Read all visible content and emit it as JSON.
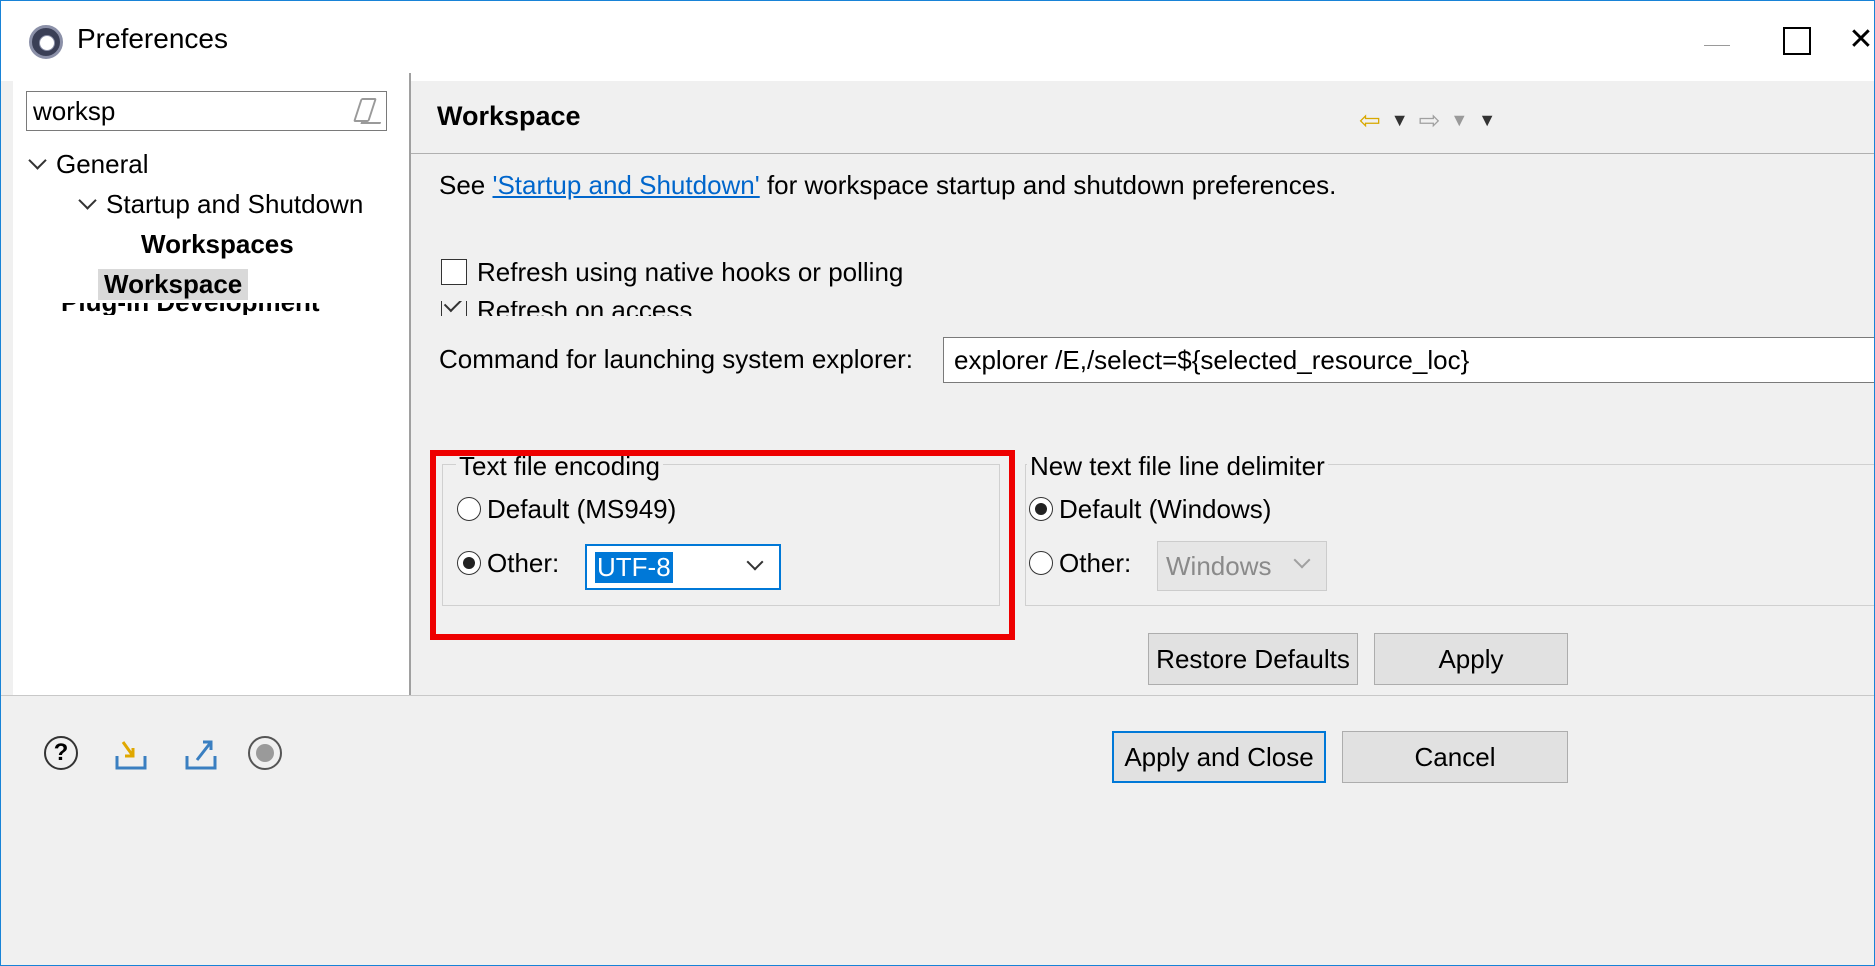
{
  "window": {
    "title": "Preferences",
    "close_glyph": "✕"
  },
  "sidebar": {
    "filter_value": "worksp",
    "tree": {
      "general": "General",
      "startup_shutdown": "Startup and Shutdown",
      "workspaces": "Workspaces",
      "workspace": "Workspace",
      "partial_item": "Plug-in Development"
    }
  },
  "page": {
    "title": "Workspace",
    "nav": {
      "back_glyph": "⇦",
      "forward_glyph": "⇨",
      "menu_glyph": "▼"
    },
    "description": {
      "prefix": "See ",
      "link": "'Startup and Shutdown'",
      "suffix": " for workspace startup and shutdown preferences."
    },
    "checkboxes": {
      "refresh_native": {
        "label": "Refresh using native hooks or polling",
        "checked": false
      },
      "refresh_access": {
        "label": "Refresh on access",
        "checked": true
      }
    },
    "explorer": {
      "label": "Command for launching system explorer:",
      "value": "explorer /E,/select=${selected_resource_loc}"
    },
    "encoding": {
      "group_label": "Text file encoding",
      "default_label": "Default (MS949)",
      "other_label": "Other:",
      "selected": "other",
      "value": "UTF-8"
    },
    "delimiter": {
      "group_label": "New text file line delimiter",
      "default_label": "Default (Windows)",
      "other_label": "Other:",
      "selected": "default",
      "value": "Windows"
    },
    "buttons": {
      "restore_defaults": "Restore Defaults",
      "apply": "Apply"
    }
  },
  "footer": {
    "help_glyph": "?",
    "apply_and_close": "Apply and Close",
    "cancel": "Cancel"
  },
  "colors": {
    "highlight": "#ee0000",
    "accent": "#0078d7",
    "link": "#0066cc"
  }
}
